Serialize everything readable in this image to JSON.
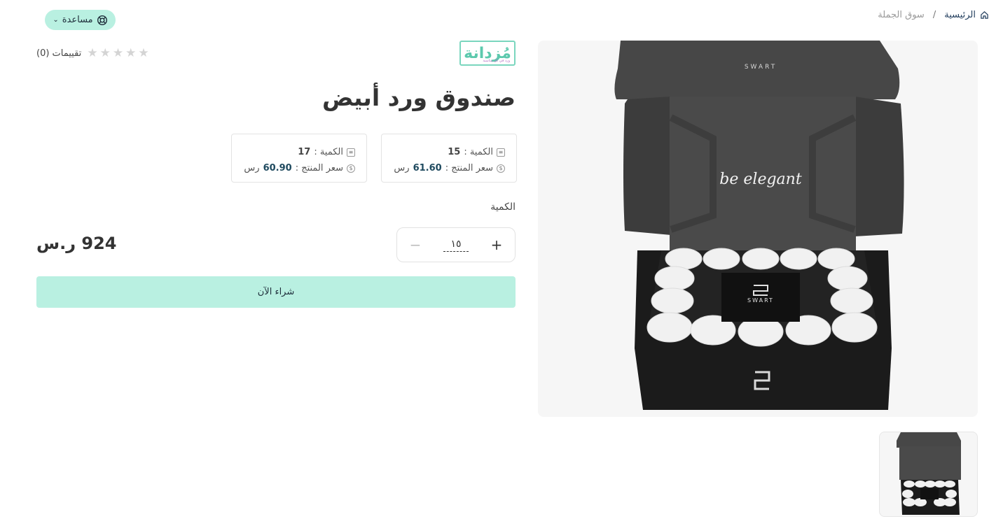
{
  "breadcrumb": {
    "home": "الرئيسية",
    "separator": "/",
    "current": "سوق الجملة"
  },
  "help": {
    "label": "مساعدة"
  },
  "brand": {
    "logo_text": "مُزدانة",
    "tagline": "ورد في كل مناسبة"
  },
  "rating": {
    "count_text": "(0) تقييمات",
    "stars": 0,
    "max_stars": 5
  },
  "product": {
    "title": "صندوق ورد أبيض"
  },
  "tiers": [
    {
      "qty_label": "الكمية :",
      "qty": "15",
      "price_label": "سعر المنتج :",
      "price": "61.60",
      "currency": "رس"
    },
    {
      "qty_label": "الكمية :",
      "qty": "17",
      "price_label": "سعر المنتج :",
      "price": "60.90",
      "currency": "رس"
    }
  ],
  "quantity": {
    "label": "الكمية",
    "value": "١٥",
    "plus": "+",
    "minus": "−"
  },
  "total": {
    "text": "924 ر.س"
  },
  "buy": {
    "label": "شراء الآن"
  },
  "box_image": {
    "lid_text": "SWART",
    "script_text": "be elegant",
    "center_text": "SWART"
  },
  "colors": {
    "accent": "#b9f0e1",
    "brand": "#5cc9ad",
    "price": "#1f4a5f"
  }
}
